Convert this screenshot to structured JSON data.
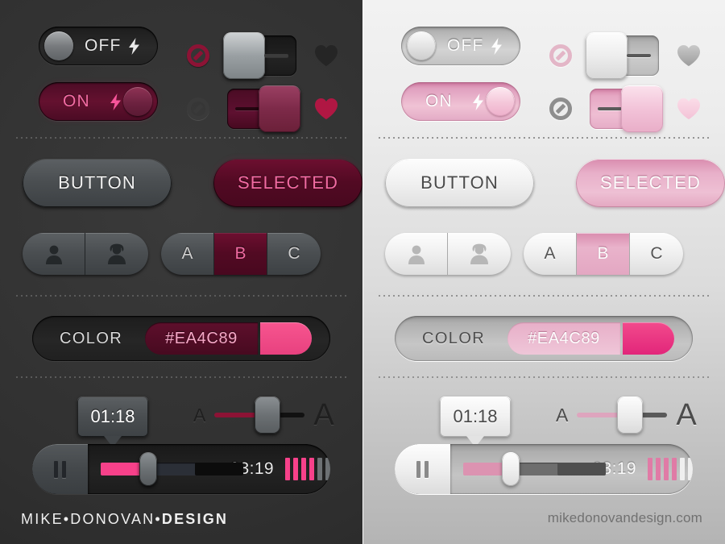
{
  "meta": {
    "accent_pink": "#EA4C89",
    "accent_crimson": "#8C1335",
    "dark_panel_bg": "#333333",
    "light_panel_bg": "#E2E2E2"
  },
  "dark_panel": {
    "toggles": {
      "off": {
        "label": "OFF",
        "icon": "bolt-icon",
        "state": "off"
      },
      "on": {
        "label": "ON",
        "icon": "bolt-icon",
        "state": "on"
      }
    },
    "icons": {
      "no_entry_top": "no-entry-icon",
      "no_entry_bottom": "no-entry-icon",
      "heart_top": "heart-icon",
      "heart_bottom": "heart-icon"
    },
    "square_switches": {
      "top_state": "off",
      "bottom_state": "on"
    },
    "buttons": {
      "normal": "BUTTON",
      "selected": "SELECTED"
    },
    "person_segments": [
      "person-male-icon",
      "person-female-icon"
    ],
    "abc_segments": [
      {
        "label": "A",
        "selected": false
      },
      {
        "label": "B",
        "selected": true
      },
      {
        "label": "C",
        "selected": false
      }
    ],
    "color_picker": {
      "label": "COLOR",
      "hex": "#EA4C89",
      "swatch": "#EA4C89"
    },
    "tooltip": {
      "time": "01:18"
    },
    "font_slider": {
      "small_label": "A",
      "large_label": "A",
      "value_percent": 48
    },
    "player": {
      "play_state": "pause",
      "pause_icon": "pause-icon",
      "elapsed": "01:18",
      "duration": "03:19",
      "progress_percent": 34,
      "buffer_percent": 78,
      "eq_bars": [
        true,
        true,
        true,
        true,
        false,
        false
      ]
    },
    "footer": {
      "pre": "MIKE•DONOVAN•",
      "bold": "DESIGN"
    }
  },
  "light_panel": {
    "toggles": {
      "off": {
        "label": "OFF",
        "icon": "bolt-icon",
        "state": "off"
      },
      "on": {
        "label": "ON",
        "icon": "bolt-icon",
        "state": "on"
      }
    },
    "icons": {
      "no_entry_top": "no-entry-icon",
      "no_entry_bottom": "no-entry-icon",
      "heart_top": "heart-icon",
      "heart_bottom": "heart-icon"
    },
    "square_switches": {
      "top_state": "off",
      "bottom_state": "on"
    },
    "buttons": {
      "normal": "BUTTON",
      "selected": "SELECTED"
    },
    "person_segments": [
      "person-male-icon",
      "person-female-icon"
    ],
    "abc_segments": [
      {
        "label": "A",
        "selected": false
      },
      {
        "label": "B",
        "selected": true
      },
      {
        "label": "C",
        "selected": false
      }
    ],
    "color_picker": {
      "label": "COLOR",
      "hex": "#EA4C89",
      "swatch": "#EA4C89"
    },
    "tooltip": {
      "time": "01:18"
    },
    "font_slider": {
      "small_label": "A",
      "large_label": "A",
      "value_percent": 48
    },
    "player": {
      "play_state": "pause",
      "pause_icon": "pause-icon",
      "elapsed": "01:18",
      "duration": "03:19",
      "progress_percent": 34,
      "buffer_percent": 78,
      "eq_bars": [
        true,
        true,
        true,
        true,
        false,
        false
      ]
    },
    "footer": {
      "url": "mikedonovandesign.com"
    }
  }
}
